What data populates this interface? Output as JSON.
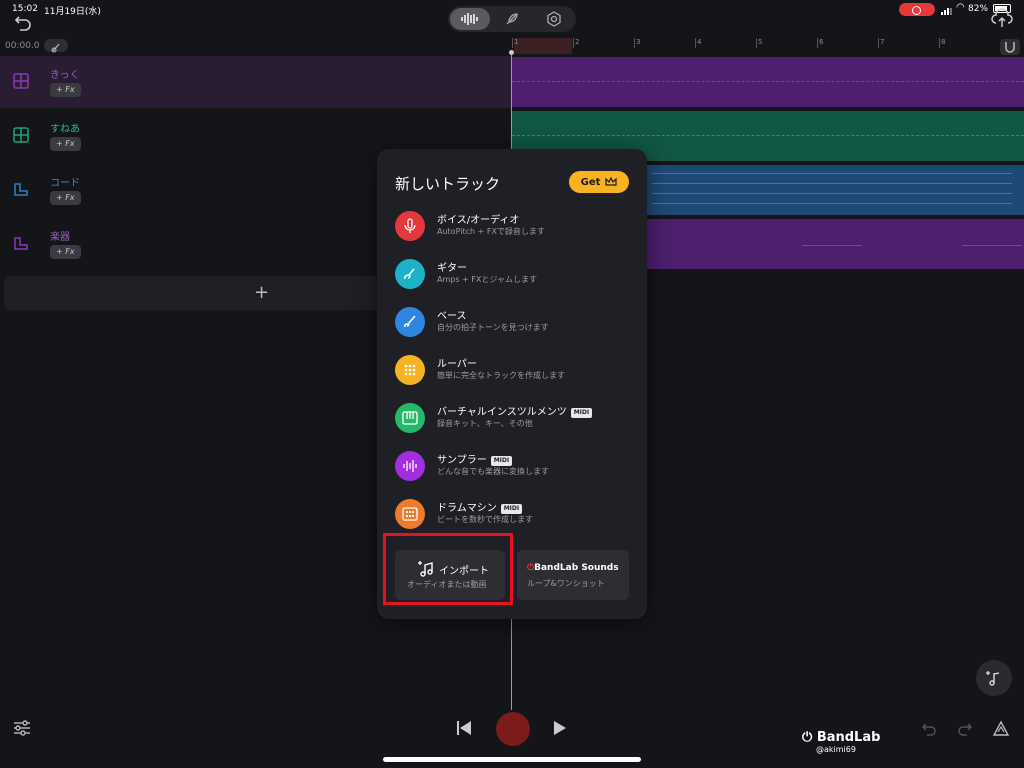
{
  "status": {
    "time": "15:02",
    "date": "11月19日(水)",
    "battery": "82%"
  },
  "transport": {
    "counter": "00:00.0"
  },
  "ruler": {
    "marks": [
      "1",
      "2",
      "3",
      "4",
      "5",
      "6",
      "7",
      "8"
    ]
  },
  "tracks": [
    {
      "name": "きっく",
      "fx": "+ Fx",
      "color": "#8a3bb7",
      "icon": "grid-icon"
    },
    {
      "name": "すねあ",
      "fx": "+ Fx",
      "color": "#1ba37a",
      "icon": "grid-icon"
    },
    {
      "name": "コード",
      "fx": "+ Fx",
      "color": "#2f7fc2",
      "icon": "keyboard-icon"
    },
    {
      "name": "楽器",
      "fx": "+ Fx",
      "color": "#8a3bb7",
      "icon": "keyboard-icon"
    }
  ],
  "modal": {
    "title": "新しいトラック",
    "get_label": "Get",
    "items": [
      {
        "label": "ボイス/オーディオ",
        "sub": "AutoPitch + FXで録音します",
        "color": "#e5383b",
        "icon": "microphone-icon",
        "midi": ""
      },
      {
        "label": "ギター",
        "sub": "Amps + FXとジャムします",
        "color": "#1cb3c8",
        "icon": "guitar-icon",
        "midi": ""
      },
      {
        "label": "ベース",
        "sub": "自分の拍子トーンを見つけます",
        "color": "#2f86e0",
        "icon": "bass-icon",
        "midi": ""
      },
      {
        "label": "ルーパー",
        "sub": "簡単に完全なトラックを作成します",
        "color": "#f5b324",
        "icon": "looper-icon",
        "midi": ""
      },
      {
        "label": "バーチャルインスツルメンツ",
        "sub": "録音キット、キー、その他",
        "color": "#25b86a",
        "icon": "keyboard-icon",
        "midi": "MIDI"
      },
      {
        "label": "サンプラー",
        "sub": "どんな音でも楽器に変換します",
        "color": "#a22ee0",
        "icon": "waveform-icon",
        "midi": "MIDI"
      },
      {
        "label": "ドラムマシン",
        "sub": "ビートを数秒で作成します",
        "color": "#f07a2b",
        "icon": "drum-machine-icon",
        "midi": "MIDI"
      }
    ],
    "import": {
      "label": "インポート",
      "sub": "オーディオまたは動画"
    },
    "sounds": {
      "brand": "BandLab",
      "brand_suffix": "Sounds",
      "sub": "ループ&ワンショット"
    }
  },
  "watermark": {
    "brand": "BandLab",
    "user": "@akimi69"
  }
}
